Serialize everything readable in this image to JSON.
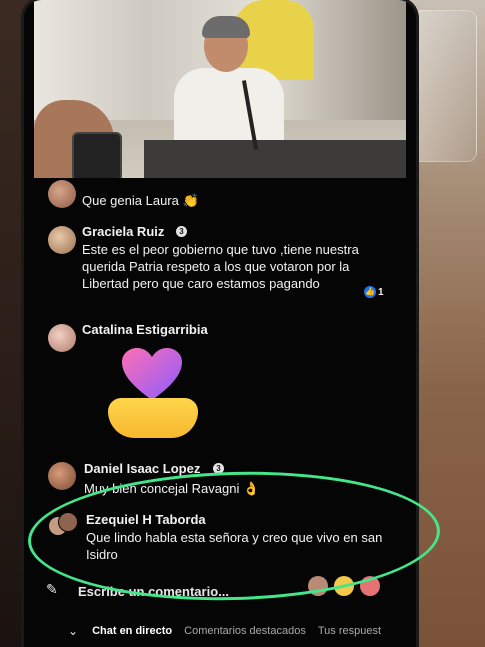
{
  "colors": {
    "background": "#050505",
    "text": "#f2f2f2",
    "accent_like": "#1877f2",
    "annotation": "#43e68a",
    "tab_active": "#ffffff",
    "tab_inactive": "#a9a9a9"
  },
  "comments": [
    {
      "author": "",
      "text": "Que genia Laura 👏"
    },
    {
      "author": "Graciela Ruiz",
      "badge": "3",
      "text": "Este es el peor gobierno que tuvo ,tiene nuestra querida Patria respeto a los que votaron por la Libertad pero que caro estamos pagando",
      "likes": "1"
    },
    {
      "author": "Catalina Estigarribia",
      "sticker": "heart-hands-sticker"
    },
    {
      "author": "Daniel Isaac Lopez",
      "badge": "3",
      "text": "Muy bien concejal Ravagni 👌"
    },
    {
      "author": "Ezequiel H Taborda",
      "text": "Que lindo habla esta señora y creo que vivo en san Isidro"
    }
  ],
  "composer": {
    "placeholder": "Escribe un comentario..."
  },
  "tabs": [
    "Chat en directo",
    "Comentarios destacados",
    "Tus respuest"
  ]
}
